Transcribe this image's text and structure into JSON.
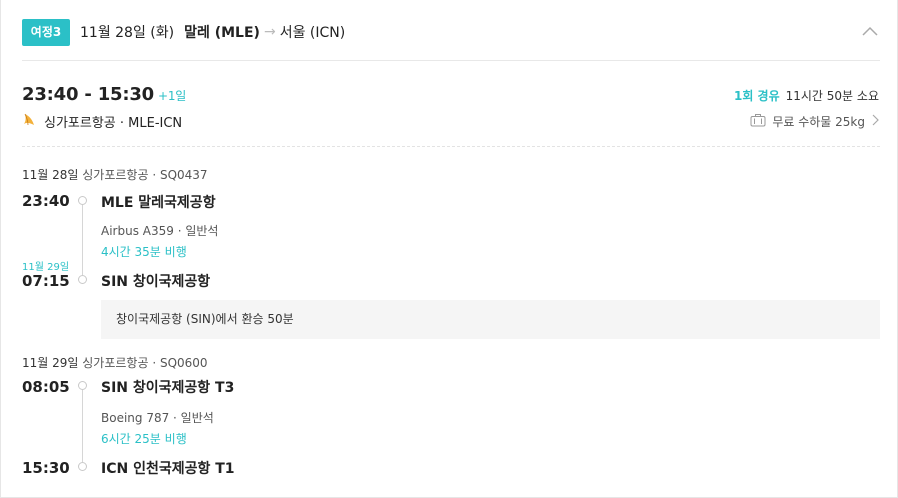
{
  "header": {
    "badge": "여정3",
    "date": "11월 28일 (화)",
    "from": "말레 (MLE)",
    "arrow": "→",
    "to": "서울 (ICN)"
  },
  "summary": {
    "time_range": "23:40 - 15:30",
    "plus_day": "+1일",
    "airline_route": "싱가포르항공 · MLE-ICN",
    "stop_count": "1회 경유",
    "total_duration": "11시간 50분 소요",
    "baggage": "무료 수하물 25kg"
  },
  "segments": [
    {
      "info_date": "11월 28일",
      "info_flight": "싱가포르항공 · SQ0437",
      "dep_time": "23:40",
      "dep_airport": "MLE 말레국제공항",
      "aircraft": "Airbus A359 · 일반석",
      "flight_time": "4시간 35분 비행",
      "arr_day_note": "11월 29일",
      "arr_time": "07:15",
      "arr_airport": "SIN 창이국제공항"
    },
    {
      "info_date": "11월 29일",
      "info_flight": "싱가포르항공 · SQ0600",
      "dep_time": "08:05",
      "dep_airport": "SIN 창이국제공항 T3",
      "aircraft": "Boeing 787 · 일반석",
      "flight_time": "6시간 25분 비행",
      "arr_time": "15:30",
      "arr_airport": "ICN 인천국제공항 T1"
    }
  ],
  "layover": "창이국제공항 (SIN)에서 환승 50분",
  "icons": {
    "collapse": "chevron-up-icon",
    "airline_logo": "singapore-airlines-logo-icon",
    "baggage": "baggage-icon",
    "chevron": "chevron-right-icon"
  },
  "colors": {
    "accent": "#2bc0c7",
    "layover_bg": "#f5f5f5"
  }
}
